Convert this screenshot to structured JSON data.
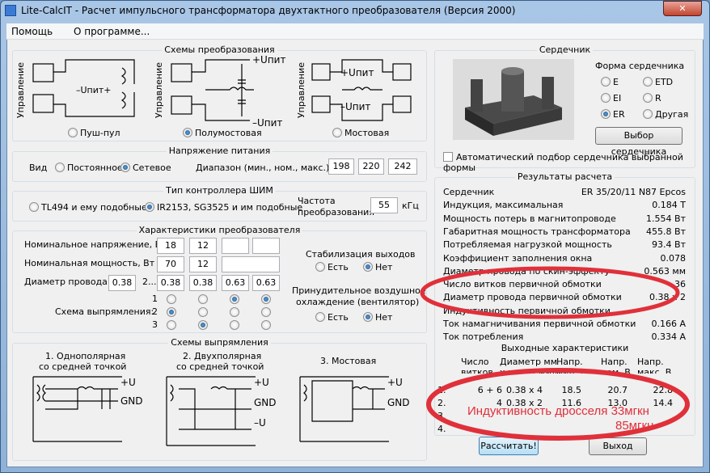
{
  "window": {
    "title": "Lite-CalcIT - Расчет импульсного трансформатора двухтактного преобразователя (Версия 2000)",
    "close": "✕"
  },
  "menu": [
    "Помощь",
    "О программе..."
  ],
  "schemes": {
    "title": "Схемы  преобразования",
    "options": [
      {
        "label": "Пуш-пул",
        "selected": false
      },
      {
        "label": "Полумостовая",
        "selected": true
      },
      {
        "label": "Мостовая",
        "selected": false
      }
    ],
    "labels": {
      "control": "Управление",
      "upit_minus_plus": "–Uпит+",
      "upit_plus": "+Uпит",
      "upit_minus": "–Uпит"
    }
  },
  "supply": {
    "title": "Напряжение питания",
    "kind_label": "Вид",
    "options": [
      {
        "label": "Постоянное",
        "selected": false
      },
      {
        "label": "Сетевое",
        "selected": true
      }
    ],
    "range_label": "Диапазон (мин., ном., макс.), В",
    "min": "198",
    "nom": "220",
    "max": "242"
  },
  "pwm": {
    "title": "Тип контроллера ШИМ",
    "options": [
      {
        "label": "TL494 и ему подобные",
        "selected": false
      },
      {
        "label": "IR2153, SG3525 и им подобные",
        "selected": true
      }
    ],
    "freq_label_1": "Частота",
    "freq_label_2": "преобразования",
    "freq": "55",
    "freq_unit": "кГц"
  },
  "conv": {
    "title": "Характеристики преобразователя",
    "voltage_label": "Номинальное напряжение, В",
    "voltages": [
      "18",
      "12",
      "",
      ""
    ],
    "power_label": "Номинальная мощность, Вт",
    "powers": [
      "70",
      "12",
      ""
    ],
    "wire_label": "Диаметр провода  1",
    "wire1": "0.38",
    "wire_sep": "2...",
    "wires": [
      "0.38",
      "0.38",
      "0.63",
      "0.63"
    ],
    "rect_label": "Схема выпрямления:",
    "rect_rows": [
      "1",
      "2",
      "3"
    ],
    "rect_selected": [
      2,
      3,
      1,
      1
    ],
    "stab_title": "Стабилизация выходов",
    "stab_options": [
      {
        "label": "Есть",
        "selected": false
      },
      {
        "label": "Нет",
        "selected": true
      }
    ],
    "cool_title_1": "Принудительное воздушное",
    "cool_title_2": "охлаждение (вентилятор)",
    "cool_options": [
      {
        "label": "Есть",
        "selected": false
      },
      {
        "label": "Нет",
        "selected": true
      }
    ]
  },
  "rect_schemes": {
    "title": "Схемы выпрямления",
    "items": [
      {
        "l1": "1. Однополярная",
        "l2": "со средней точкой"
      },
      {
        "l1": "2. Двухполярная",
        "l2": "со средней точкой"
      },
      {
        "l1": "3. Мостовая",
        "l2": ""
      }
    ],
    "plus_u": "+U",
    "gnd": "GND",
    "minus_u": "–U"
  },
  "core": {
    "title": "Сердечник",
    "shape_title": "Форма сердечника",
    "shapes": [
      {
        "label": "E",
        "selected": false
      },
      {
        "label": "ETD",
        "selected": false
      },
      {
        "label": "EI",
        "selected": false
      },
      {
        "label": "R",
        "selected": false
      },
      {
        "label": "ER",
        "selected": true
      },
      {
        "label": "Другая",
        "selected": false
      }
    ],
    "select_button": "Выбор сердечника",
    "auto_label": "Автоматический подбор сердечника выбранной формы",
    "auto_checked": false
  },
  "results": {
    "title": "Результаты расчета",
    "rows": [
      {
        "label": "Сердечник",
        "value": "ER 35/20/11 N87 Epcos"
      },
      {
        "label": "Индукция, максимальная",
        "value": "0.184 Т"
      },
      {
        "label": "Мощность потерь в магнитопроводе",
        "value": "1.554 Вт"
      },
      {
        "label": "Габаритная мощность трансформатора",
        "value": "455.8 Вт"
      },
      {
        "label": "Потребляемая нагрузкой мощность",
        "value": "93.4 Вт"
      },
      {
        "label": "Коэффициент заполнения окна",
        "value": "0.078"
      },
      {
        "label": "Диаметр провода по скин-эффекту",
        "value": "0.563 мм"
      },
      {
        "label": "Число витков первичной обмотки",
        "value": "36"
      },
      {
        "label": "Диаметр провода первичной обмотки",
        "value": "0.38 x 2"
      },
      {
        "label": "Индуктивность первичной обмотки",
        "value": ""
      },
      {
        "label": "Ток намагничивания первичной обмотки",
        "value": "0.166 А"
      },
      {
        "label": "Ток потребления",
        "value": "0.334 А"
      }
    ],
    "out_title": "Выходные характеристики",
    "out_headers": [
      [
        "Число",
        "витков"
      ],
      [
        "Диаметр мм",
        "x число жил"
      ],
      [
        "Напр.",
        "мин. В"
      ],
      [
        "Напр.",
        "ном. В"
      ],
      [
        "Напр.",
        "макс. В"
      ]
    ],
    "out_rows": [
      [
        "1.",
        "6 + 6",
        "0.38 x 4",
        "18.5",
        "20.7",
        "22.8"
      ],
      [
        "2.",
        "4",
        "0.38 x 2",
        "11.6",
        "13.0",
        "14.4"
      ],
      [
        "3.",
        "",
        "",
        "",
        "",
        ""
      ],
      [
        "4.",
        "",
        "",
        "",
        "",
        ""
      ]
    ]
  },
  "annotation": {
    "line1": "Индуктивность дросселя 33мгкн",
    "line2": "85мгкн",
    "color": "#e0303a"
  },
  "buttons": {
    "calc": "Рассчитать!",
    "exit": "Выход"
  }
}
